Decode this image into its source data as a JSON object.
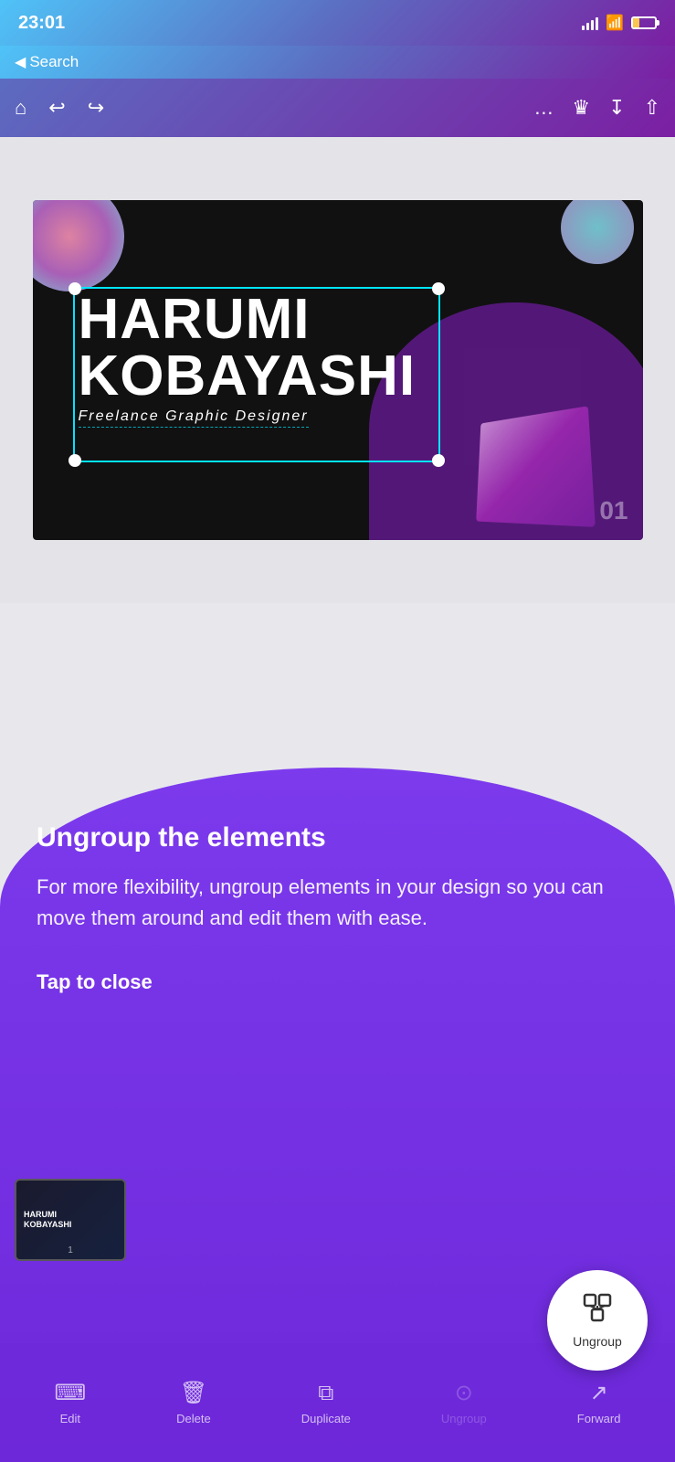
{
  "status": {
    "time": "23:01",
    "back_label": "Search"
  },
  "toolbar": {
    "home_label": "home",
    "undo_label": "undo",
    "redo_label": "redo",
    "more_label": "more",
    "crown_label": "premium",
    "download_label": "download",
    "share_label": "share"
  },
  "design": {
    "name_line1": "HARUMI",
    "name_line2": "KOBAYASHI",
    "subtitle": "Freelance Graphic Designer",
    "page_number": "01"
  },
  "tooltip": {
    "title": "Ungroup the elements",
    "description": "For more flexibility, ungroup elements in your design so you can move them around and edit them with ease.",
    "tap_label": "Tap to close"
  },
  "bottom_tools": [
    {
      "icon": "⌨",
      "label": "Edit"
    },
    {
      "icon": "🗑",
      "label": "Delete"
    },
    {
      "icon": "⧉",
      "label": "Duplicate"
    },
    {
      "icon": "⊙",
      "label": "Ungroup"
    },
    {
      "icon": "↗",
      "label": "Forward"
    }
  ],
  "ungroup_fab": {
    "label": "Ungroup"
  },
  "thumbnail": {
    "page": "1"
  },
  "colors": {
    "accent": "#7c3aed",
    "header_gradient_start": "#4fc3f7",
    "header_gradient_end": "#7b1fa2"
  }
}
